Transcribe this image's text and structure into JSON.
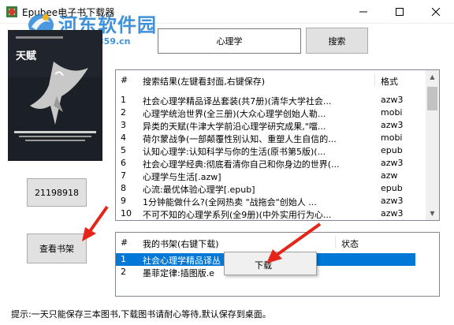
{
  "window": {
    "title": "Epubee电子书下载器"
  },
  "watermark": {
    "name": "河东软件园",
    "url": "www.pc0359.cn"
  },
  "cover": {
    "title": "天赋",
    "icon": "eagle-illustration"
  },
  "search": {
    "query": "心理学",
    "button_label": "搜索"
  },
  "book_id_button": {
    "label": "21198918"
  },
  "view_shelf_button": {
    "label": "查看书架"
  },
  "results": {
    "columns": {
      "num": "#",
      "title": "搜索结果(左键看封面,右键保存)",
      "format": "格式"
    },
    "rows": [
      {
        "num": "1",
        "title": "社会心理学精品译丛套装(共7册)(清华大学社会...",
        "format": "azw3"
      },
      {
        "num": "2",
        "title": "心理学统治世界(全三册)(大众心理学创始人勒...",
        "format": "mobi"
      },
      {
        "num": "3",
        "title": "异类的天赋(牛津大学前沿心理学研究成果,\"噹...",
        "format": "azw3"
      },
      {
        "num": "4",
        "title": "荷尔蒙战争(一部颠覆性别认知、重塑人生自信的...",
        "format": "mobi"
      },
      {
        "num": "5",
        "title": "认知心理学:认知科学与你的生活(原书第5版)(...",
        "format": "epub"
      },
      {
        "num": "6",
        "title": "社会心理学经典:彻底看清你自己和你身边的世界(...",
        "format": "azw3"
      },
      {
        "num": "7",
        "title": "心理学与生活[.azw]",
        "format": "azw"
      },
      {
        "num": "8",
        "title": "心流:最优体验心理学[.epub]",
        "format": "epub"
      },
      {
        "num": "9",
        "title": "1分钟能做什么?(全网热卖 \"战拖会\"创始人 ...",
        "format": "azw3"
      },
      {
        "num": "10",
        "title": "不可不知的心理学系列(全9册)(中外实用行为心...",
        "format": "azw3"
      }
    ]
  },
  "shelf": {
    "columns": {
      "num": "#",
      "title": "我的书架(右键下载)",
      "status": "状态"
    },
    "rows": [
      {
        "num": "1",
        "title": "社会心理学精品译丛",
        "status": ""
      },
      {
        "num": "2",
        "title": "墨菲定律:插图版.e",
        "status": ""
      }
    ]
  },
  "context_menu": {
    "download_label": "下载"
  },
  "status_text": "提示:一天只能保存三本图书,下载图书请耐心等待,默认保存到桌面。",
  "colors": {
    "selection": "#0078d7",
    "arrow": "#e32619",
    "watermark": "#2c86d8"
  }
}
